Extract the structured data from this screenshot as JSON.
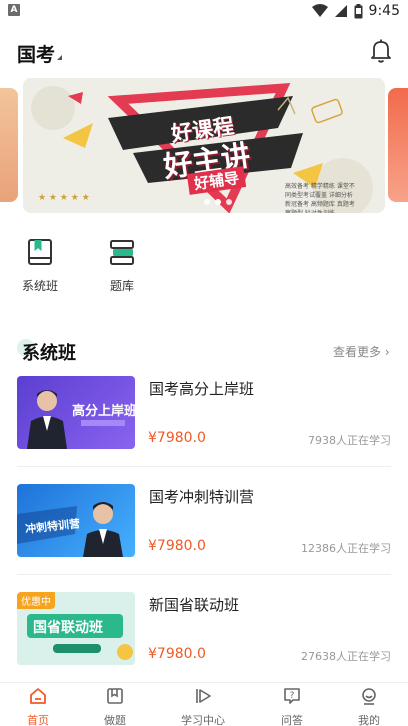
{
  "status_bar": {
    "app_indicator": "A",
    "time": "9:45"
  },
  "header": {
    "title": "国考"
  },
  "banner": {
    "line1": "好课程",
    "line2": "好主讲",
    "line3": "好辅导",
    "fine_print": "高效备考 精学精练 课堂不同类型考试覆盖 详细分析 新冠备考 高频题库 真题考察题型 针对性训练"
  },
  "quick_nav": [
    {
      "label": "系统班",
      "icon": "book-bookmark-icon"
    },
    {
      "label": "题库",
      "icon": "stack-books-icon"
    }
  ],
  "section": {
    "title": "系统班",
    "more_label": "查看更多 ›"
  },
  "courses": [
    {
      "name": "国考高分上岸班",
      "price": "¥7980.0",
      "learners": "7938人正在学习",
      "thumb_text": "高分上岸班",
      "badge": ""
    },
    {
      "name": "国考冲刺特训营",
      "price": "¥7980.0",
      "learners": "12386人正在学习",
      "thumb_text": "冲刺特训营",
      "badge": ""
    },
    {
      "name": "新国省联动班",
      "price": "¥7980.0",
      "learners": "27638人正在学习",
      "thumb_text": "国省联动班",
      "badge": "优惠中"
    }
  ],
  "tabbar": [
    {
      "label": "首页",
      "icon": "home-icon",
      "active": true
    },
    {
      "label": "做题",
      "icon": "bookmark-icon",
      "active": false
    },
    {
      "label": "学习中心",
      "icon": "play-icon",
      "active": false
    },
    {
      "label": "问答",
      "icon": "question-icon",
      "active": false
    },
    {
      "label": "我的",
      "icon": "profile-icon",
      "active": false
    }
  ],
  "colors": {
    "accent": "#f05a28",
    "price": "#f05a28",
    "banner_red": "#e0304a",
    "teal": "#2bb88c"
  }
}
